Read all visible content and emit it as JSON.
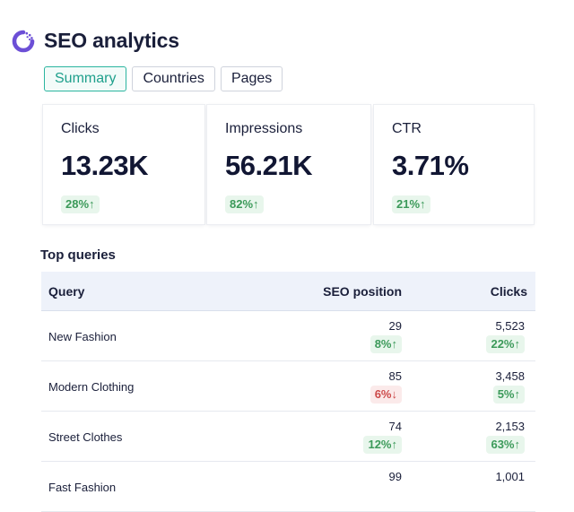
{
  "app": {
    "title": "SEO analytics"
  },
  "tabs": [
    {
      "label": "Summary",
      "active": true
    },
    {
      "label": "Countries",
      "active": false
    },
    {
      "label": "Pages",
      "active": false
    }
  ],
  "kpis": [
    {
      "label": "Clicks",
      "value": "13.23K",
      "change": "28%↑",
      "direction": "up"
    },
    {
      "label": "Impressions",
      "value": "56.21K",
      "change": "82%↑",
      "direction": "up"
    },
    {
      "label": "CTR",
      "value": "3.71%",
      "change": "21%↑",
      "direction": "up"
    }
  ],
  "top_queries": {
    "title": "Top queries",
    "columns": [
      "Query",
      "SEO position",
      "Clicks"
    ],
    "rows": [
      {
        "query": "New Fashion",
        "position": "29",
        "position_change": "8%↑",
        "position_dir": "up",
        "clicks": "5,523",
        "clicks_change": "22%↑",
        "clicks_dir": "up"
      },
      {
        "query": "Modern Clothing",
        "position": "85",
        "position_change": "6%↓",
        "position_dir": "down",
        "clicks": "3,458",
        "clicks_change": "5%↑",
        "clicks_dir": "up"
      },
      {
        "query": "Street Clothes",
        "position": "74",
        "position_change": "12%↑",
        "position_dir": "up",
        "clicks": "2,153",
        "clicks_change": "63%↑",
        "clicks_dir": "up"
      },
      {
        "query": "Fast Fashion",
        "position": "99",
        "position_change": "",
        "position_dir": "",
        "clicks": "1,001",
        "clicks_change": "",
        "clicks_dir": ""
      }
    ]
  },
  "colors": {
    "accent": "#2bb5a0",
    "logo": "#6c4fd6",
    "positive": "#3c9a5a",
    "negative": "#cc4a4a"
  },
  "icons": {
    "logo": "spinner-logo-icon"
  }
}
